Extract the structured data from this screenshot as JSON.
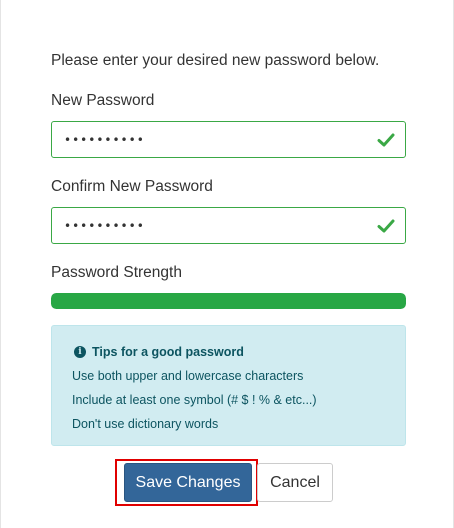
{
  "form": {
    "intro": "Please enter your desired new password below.",
    "new_password": {
      "label": "New Password",
      "value": "••••••••••",
      "valid": true
    },
    "confirm_password": {
      "label": "Confirm New Password",
      "value": "••••••••••",
      "valid": true
    },
    "strength": {
      "label": "Password Strength",
      "level": 1.0,
      "color": "#28a745"
    }
  },
  "tips": {
    "icon": "info-icon",
    "title": "Tips for a good password",
    "items": [
      "Use both upper and lowercase characters",
      "Include at least one symbol (# $ ! % & etc...)",
      "Don't use dictionary words"
    ]
  },
  "actions": {
    "save_label": "Save Changes",
    "cancel_label": "Cancel"
  },
  "colors": {
    "valid": "#3aa845",
    "primary": "#336699",
    "highlight": "#e00000",
    "tips_bg": "#d1ecf1",
    "tips_text": "#0c5460"
  }
}
